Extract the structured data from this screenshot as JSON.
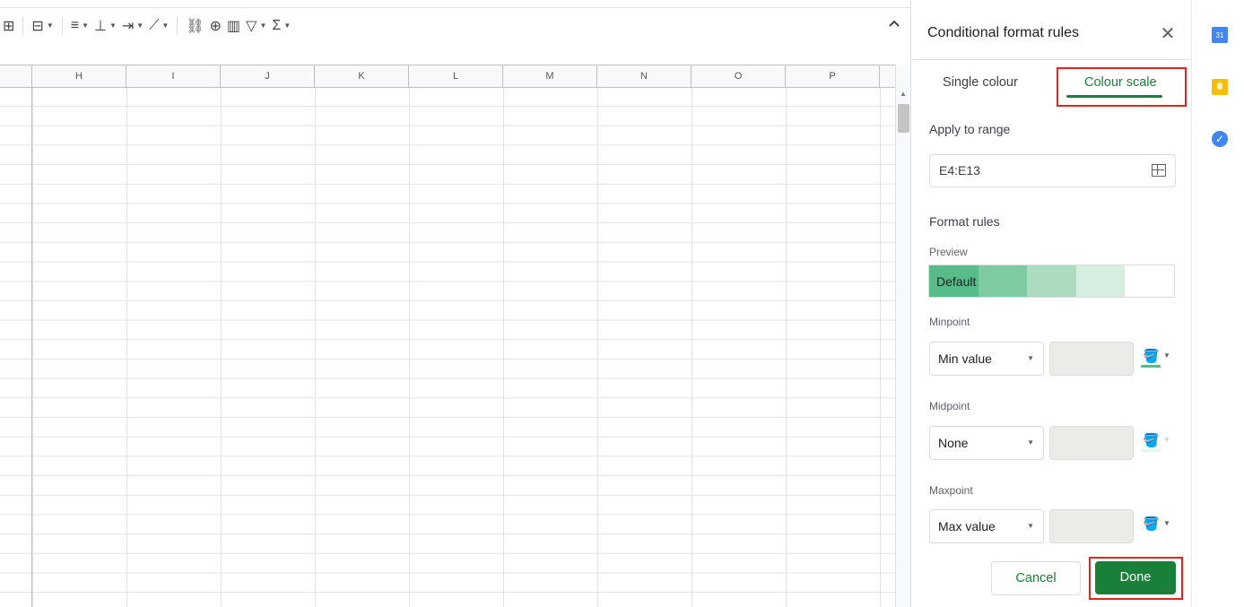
{
  "sheet": {
    "columns": [
      "H",
      "I",
      "J",
      "K",
      "L",
      "M",
      "N",
      "O",
      "P"
    ]
  },
  "panel": {
    "title": "Conditional format rules",
    "tabs": {
      "single": "Single colour",
      "scale": "Colour scale"
    },
    "apply_to_range_label": "Apply to range",
    "range_value": "E4:E13",
    "format_rules_label": "Format rules",
    "preview_label": "Preview",
    "preview_text": "Default",
    "preview_colors": [
      "#57bb8a",
      "#7ecba1",
      "#abdcc0",
      "#d5eee0",
      "#ffffff"
    ],
    "minpoint": {
      "label": "Minpoint",
      "value": "Min value",
      "color": "#57bb8a"
    },
    "midpoint": {
      "label": "Midpoint",
      "value": "None",
      "color": "#e8f5ee"
    },
    "maxpoint": {
      "label": "Maxpoint",
      "value": "Max value",
      "color": "#ffffff"
    },
    "cancel_label": "Cancel",
    "done_label": "Done"
  },
  "side_apps": {
    "calendar_day": "31"
  },
  "colors": {
    "accent_green": "#188038",
    "highlight_red": "#e02424"
  }
}
